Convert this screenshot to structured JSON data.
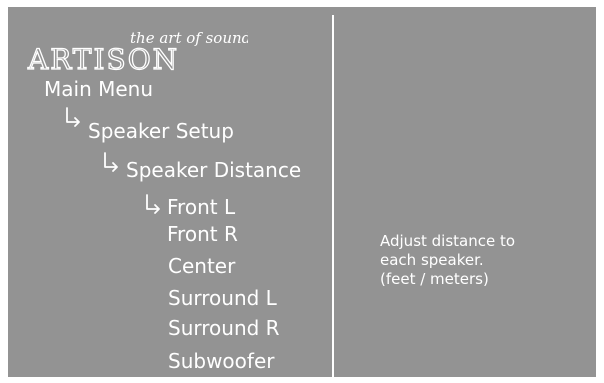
{
  "logo": {
    "tagline": "the art of sound",
    "brand": "ARTISON"
  },
  "menu": {
    "main": "Main Menu",
    "speaker_setup": "Speaker Setup",
    "speaker_distance": "Speaker Distance",
    "items": [
      "Front L",
      "Front R",
      "Center",
      "Surround L",
      "Surround R",
      "Subwoofer"
    ],
    "selected": "Front L"
  },
  "help": {
    "lines": [
      "Adjust distance to",
      "each speaker.",
      "(feet / meters)"
    ]
  },
  "colors": {
    "background": "#939393",
    "text": "#ffffff",
    "divider": "#ffffff"
  },
  "icons": {
    "submenu_arrow": "arrow-down-right-icon"
  }
}
